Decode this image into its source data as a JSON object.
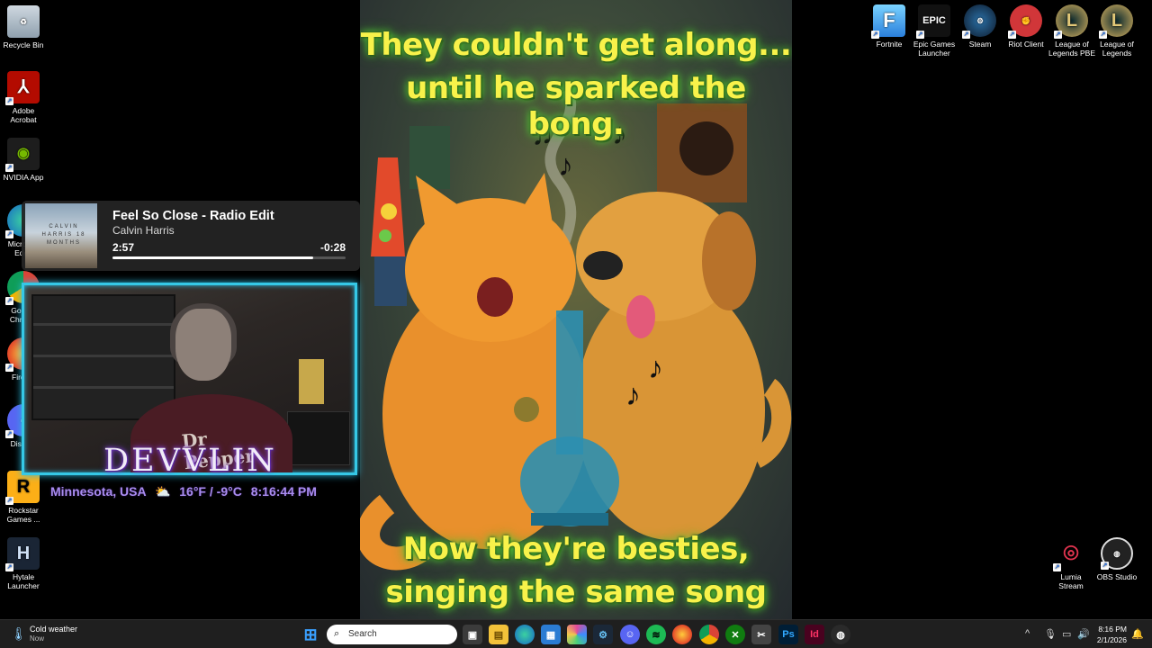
{
  "desktop_left": [
    {
      "label": "Recycle Bin",
      "icon": "recycle-bin-icon"
    },
    {
      "label": "Adobe Acrobat",
      "icon": "adobe-acrobat-icon"
    },
    {
      "label": "NVIDIA App",
      "icon": "nvidia-icon"
    },
    {
      "label": "Microsoft Edge",
      "icon": "edge-icon"
    },
    {
      "label": "Google Chrome",
      "icon": "chrome-icon"
    },
    {
      "label": "Firefox",
      "icon": "firefox-icon"
    },
    {
      "label": "Discord",
      "icon": "discord-icon"
    },
    {
      "label": "Rockstar Games ...",
      "icon": "rockstar-icon"
    },
    {
      "label": "Hytale Launcher",
      "icon": "hytale-icon"
    }
  ],
  "desktop_right": [
    {
      "label": "Fortnite",
      "icon": "fortnite-icon"
    },
    {
      "label": "Epic Games Launcher",
      "icon": "epic-games-icon"
    },
    {
      "label": "Steam",
      "icon": "steam-icon"
    },
    {
      "label": "Riot Client",
      "icon": "riot-client-icon"
    },
    {
      "label": "League of Legends PBE",
      "icon": "league-pbe-icon"
    },
    {
      "label": "League of Legends",
      "icon": "league-icon"
    }
  ],
  "desktop_bottom_right": [
    {
      "label": "Lumia Stream",
      "icon": "lumia-stream-icon"
    },
    {
      "label": "OBS Studio",
      "icon": "obs-studio-icon"
    }
  ],
  "art": {
    "top_line1": "They couldn't get along...",
    "top_line2": "until he sparked the bong.",
    "bottom_line1": "Now they're besties,",
    "bottom_line2": "singing the same song"
  },
  "now_playing": {
    "title": "Feel So Close - Radio Edit",
    "artist": "Calvin Harris",
    "elapsed": "2:57",
    "remaining": "-0:28",
    "progress": 0.86,
    "cover_text": "CALVIN HARRIS 18 MONTHS"
  },
  "overlay": {
    "brand": "DEVVLIN",
    "location": "Minnesota, USA",
    "temp": "16°F / -9°C",
    "time": "8:16:44 PM",
    "shirt": "Dr Pepper"
  },
  "taskbar": {
    "weather_title": "Cold weather",
    "weather_sub": "Now",
    "search_label": "Search",
    "clock_time": "8:16 PM",
    "clock_date": "2/1/2026"
  },
  "colors": {
    "caption": "#f8f24a",
    "cam_border": "#35c8e6",
    "brand_glow": "#7c3fd6"
  }
}
